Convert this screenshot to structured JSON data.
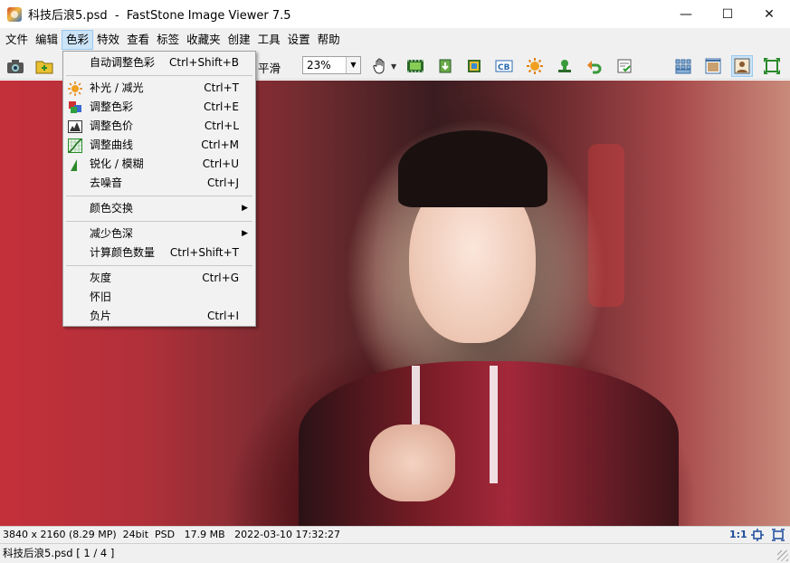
{
  "window": {
    "title": "科技后浪5.psd  -  FastStone Image Viewer 7.5",
    "controls": {
      "minimize": "—",
      "maximize": "☐",
      "close": "✕"
    }
  },
  "menubar": {
    "items": [
      "文件",
      "编辑",
      "色彩",
      "特效",
      "查看",
      "标签",
      "收藏夹",
      "创建",
      "工具",
      "设置",
      "帮助"
    ],
    "active_index": 2
  },
  "toolbar": {
    "smooth_label": "平滑",
    "zoom_value": "23%",
    "icons": [
      "camera-icon",
      "open-folder-icon",
      "hand-pan-icon",
      "slideshow-icon",
      "export-icon",
      "crop-icon",
      "compare-icon",
      "effects-icon",
      "stamp-icon",
      "undo-icon",
      "batch-icon",
      "thumbnails-icon",
      "browser-icon",
      "fullscreen-person-icon",
      "fit-screen-icon"
    ]
  },
  "color_menu": {
    "items": [
      {
        "label": "自动调整色彩",
        "shortcut": "Ctrl+Shift+B",
        "icon": "",
        "submenu": false
      },
      {
        "separator": true
      },
      {
        "label": "补光 / 减光",
        "shortcut": "Ctrl+T",
        "icon": "sun-icon",
        "submenu": false
      },
      {
        "label": "调整色彩",
        "shortcut": "Ctrl+E",
        "icon": "color-squares-icon",
        "submenu": false
      },
      {
        "label": "调整色价",
        "shortcut": "Ctrl+L",
        "icon": "levels-icon",
        "submenu": false
      },
      {
        "label": "调整曲线",
        "shortcut": "Ctrl+M",
        "icon": "curves-icon",
        "submenu": false
      },
      {
        "label": "锐化 / 模糊",
        "shortcut": "Ctrl+U",
        "icon": "sharpen-icon",
        "submenu": false
      },
      {
        "label": "去噪音",
        "shortcut": "Ctrl+J",
        "icon": "",
        "submenu": false
      },
      {
        "separator": true
      },
      {
        "label": "颜色交换",
        "shortcut": "",
        "icon": "",
        "submenu": true
      },
      {
        "separator": true
      },
      {
        "label": "减少色深",
        "shortcut": "",
        "icon": "",
        "submenu": true
      },
      {
        "label": "计算颜色数量",
        "shortcut": "Ctrl+Shift+T",
        "icon": "",
        "submenu": false
      },
      {
        "separator": true
      },
      {
        "label": "灰度",
        "shortcut": "Ctrl+G",
        "icon": "",
        "submenu": false
      },
      {
        "label": "怀旧",
        "shortcut": "",
        "icon": "",
        "submenu": false
      },
      {
        "label": "负片",
        "shortcut": "Ctrl+I",
        "icon": "",
        "submenu": false
      }
    ]
  },
  "status": {
    "info": "3840 x 2160 (8.29 MP)  24bit  PSD   17.9 MB   2022-03-10 17:32:27",
    "ratio": "1:1"
  },
  "bottom": {
    "file_position": "科技后浪5.psd [ 1 / 4 ]"
  },
  "colors": {
    "menu_highlight": "#cce4f7",
    "menu_highlight_border": "#99c9ef",
    "chrome": "#f0f0f0"
  }
}
